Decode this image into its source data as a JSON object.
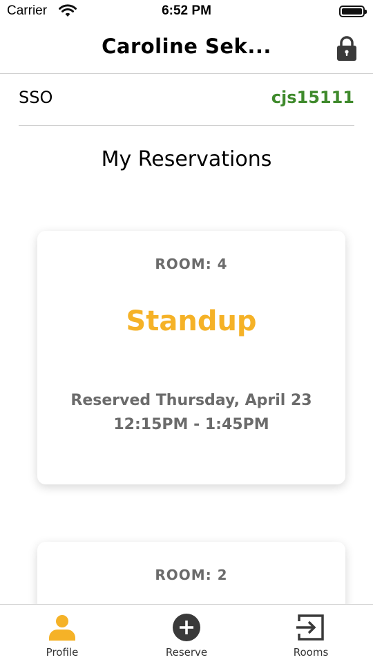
{
  "status_bar": {
    "carrier": "Carrier",
    "time": "6:52 PM"
  },
  "nav": {
    "title": "Caroline Sek..."
  },
  "sso": {
    "label": "SSO",
    "value": "cjs15111"
  },
  "section_title": "My Reservations",
  "reservations": [
    {
      "room": "ROOM: 4",
      "meeting": "Standup",
      "reserved": "Reserved Thursday, April 23",
      "time_range": "12:15PM - 1:45PM"
    },
    {
      "room": "ROOM: 2"
    }
  ],
  "tabs": [
    {
      "label": "Profile",
      "icon": "person-icon",
      "active": true
    },
    {
      "label": "Reserve",
      "icon": "plus-circle-icon",
      "active": false
    },
    {
      "label": "Rooms",
      "icon": "exit-door-icon",
      "active": false
    }
  ],
  "colors": {
    "accent": "#f5b227",
    "sso_value": "#3f8a2c",
    "card_text": "#6b6b6b"
  }
}
